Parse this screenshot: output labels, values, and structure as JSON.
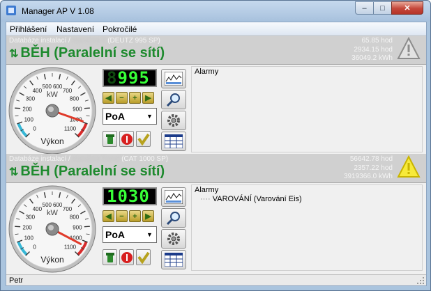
{
  "window": {
    "title": "Manager AP   V 1.08",
    "min_label": "–",
    "max_label": "□",
    "close_label": "✕"
  },
  "menu": [
    "Přihlášení",
    "Nastavení",
    "Pokročilé"
  ],
  "units": [
    {
      "db_prefix": "Databáze instalací /",
      "db_name": "Mandora 1",
      "model": "(DEUTZ 995 SP)",
      "status_arrows": "⇅",
      "status": "BĚH (Paralelní se sítí)",
      "stats": [
        "65.85 hod",
        "2934.15 hod",
        "36049.2 kWh"
      ],
      "warning_color": "#9c9c9c",
      "gauge": {
        "unit": "kW",
        "label": "Výkon",
        "ticks": [
          "0",
          "100",
          "200",
          "300",
          "400",
          "500",
          "600",
          "700",
          "800",
          "900",
          "1000",
          "1100"
        ],
        "max": 1100,
        "value": 995
      },
      "lcd": {
        "dim": "",
        "value": "995",
        "prefix_dim": "8"
      },
      "mode": "PoA",
      "alarms_label": "Alarmy",
      "alarms": []
    },
    {
      "db_prefix": "Databáze instalací /",
      "db_name": "Mandora Trend",
      "model": "(CAT 1000 SP)",
      "status_arrows": "⇅",
      "status": "BĚH (Paralelní se sítí)",
      "stats": [
        "56642.78 hod",
        "2357.22 hod",
        "3919366.0 kWh"
      ],
      "warning_color": "#f5e12a",
      "gauge": {
        "unit": "kW",
        "label": "Výkon",
        "ticks": [
          "0",
          "100",
          "200",
          "300",
          "400",
          "500",
          "600",
          "700",
          "800",
          "900",
          "1000",
          "1100"
        ],
        "max": 1100,
        "value": 1030
      },
      "lcd": {
        "value": "1030"
      },
      "mode": "PoA",
      "alarms_label": "Alarmy",
      "alarms": [
        {
          "dots": "····",
          "text": "VAROVÁNÍ (Varování Eis)"
        }
      ]
    }
  ],
  "statusbar": {
    "user": "Petr"
  },
  "buttons": {
    "up": "◀",
    "down": "▶",
    "minus": "−",
    "plus": "+",
    "select_arrow": "▼"
  }
}
